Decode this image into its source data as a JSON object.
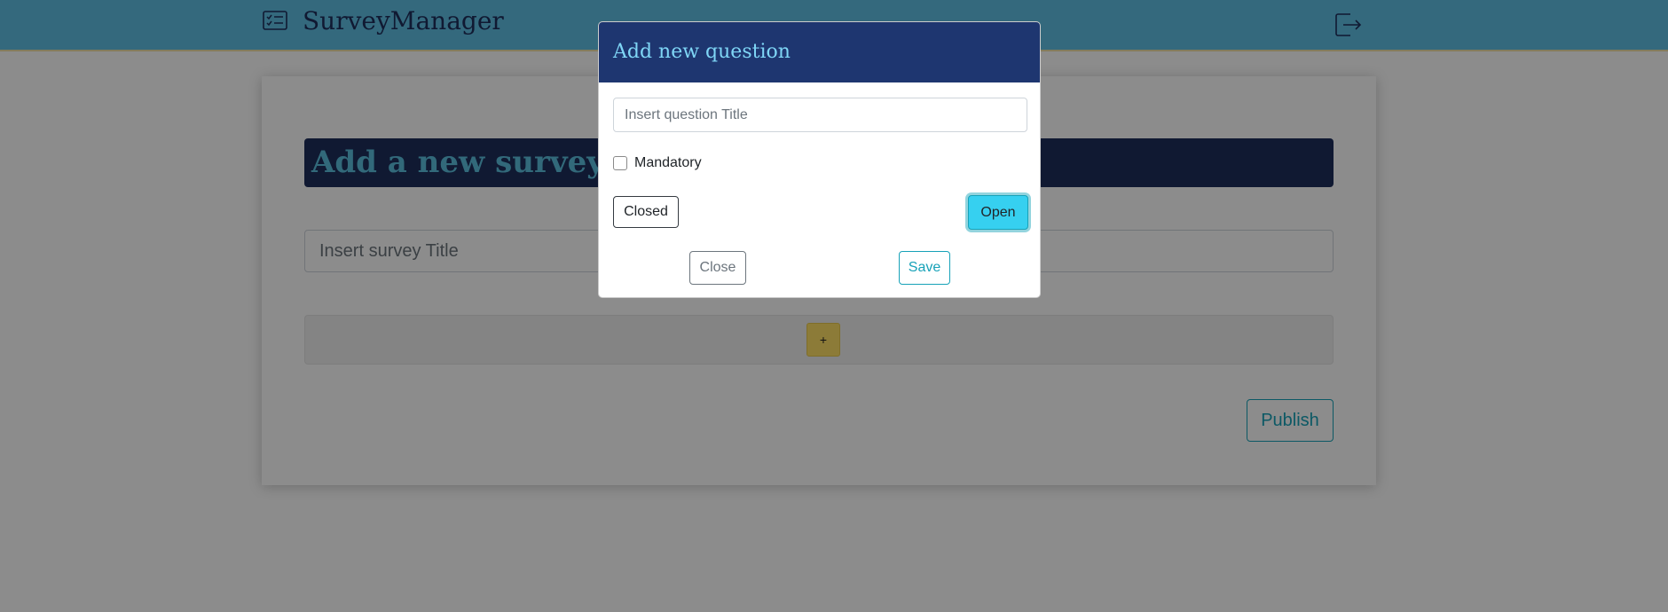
{
  "navbar": {
    "brand_icon": "survey-list-icon",
    "brand_title": "SurveyManager",
    "logout_icon": "logout-icon",
    "background_color": "#5fbfe3"
  },
  "survey_form": {
    "heading": "Add a new survey",
    "title_placeholder": "Insert survey Title",
    "add_question_label": "+",
    "publish_label": "Publish"
  },
  "modal": {
    "title": "Add new question",
    "question_title_placeholder": "Insert question Title",
    "mandatory_label": "Mandatory",
    "mandatory_checked": false,
    "closed_label": "Closed",
    "open_label": "Open",
    "close_label": "Close",
    "save_label": "Save",
    "header_color": "#1e3670",
    "accent_color": "#17a2b8"
  }
}
